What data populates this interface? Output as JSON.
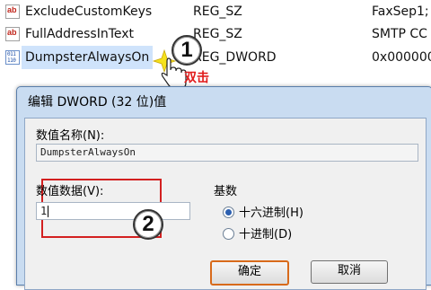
{
  "registry": {
    "rows": [
      {
        "icon": "ab",
        "name": "ExcludeCustomKeys",
        "type": "REG_SZ",
        "data": "FaxSep1;"
      },
      {
        "icon": "ab",
        "name": "FullAddressInText",
        "type": "REG_SZ",
        "data": "SMTP CC"
      },
      {
        "icon": "binary",
        "name": "DumpsterAlwaysOn",
        "type": "REG_DWORD",
        "data": "0x000000"
      }
    ]
  },
  "callouts": {
    "one": "1",
    "two": "2"
  },
  "double_click_label": "双击",
  "dialog": {
    "title": "编辑 DWORD (32 位)值",
    "value_name_label": "数值名称(N):",
    "value_name": "DumpsterAlwaysOn",
    "value_data_label": "数值数据(V):",
    "value_data": "1",
    "base_label": "基数",
    "hex_label": "十六进制(H)",
    "dec_label": "十进制(D)",
    "ok_label": "确定",
    "cancel_label": "取消"
  },
  "colors": {
    "selection": "#cfe3fb",
    "accent_red": "#d32020",
    "dialog_frame": "#c9dcf1"
  }
}
